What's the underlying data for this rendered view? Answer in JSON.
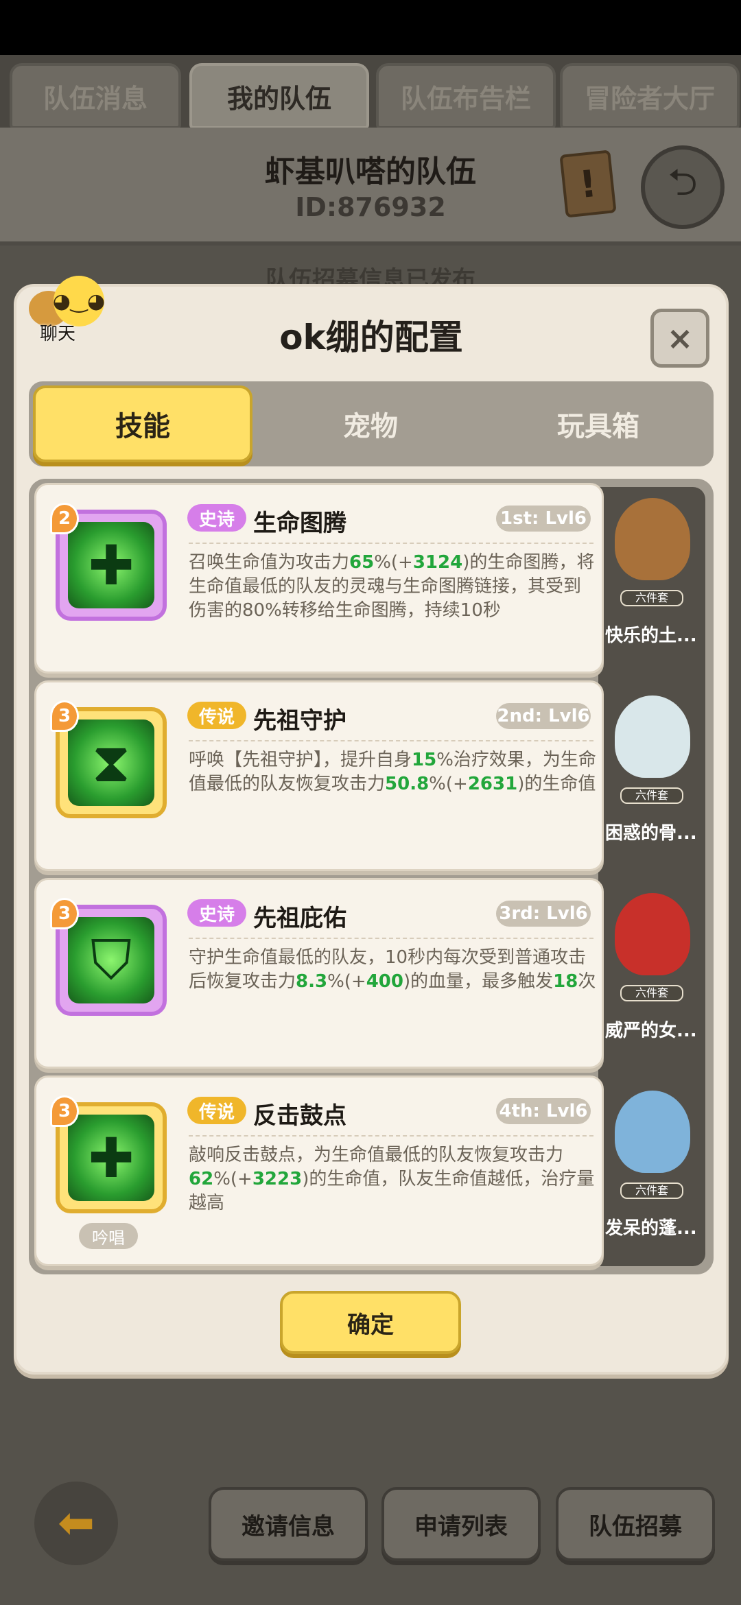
{
  "top_tabs": [
    "队伍消息",
    "我的队伍",
    "队伍布告栏",
    "冒险者大厅"
  ],
  "team": {
    "name": "虾基叭嗒的队伍",
    "id": "ID:876932"
  },
  "bg_notice": "队伍招募信息已发布",
  "chat_label": "聊天",
  "modal": {
    "title": "ok绷的配置",
    "close": "×",
    "categories": [
      "技能",
      "宠物",
      "玩具箱"
    ],
    "confirm": "确定"
  },
  "skills": [
    {
      "badge": "2",
      "rarity": "史诗",
      "name": "生命图腾",
      "level": "1st: Lvl6",
      "desc": [
        {
          "t": "召唤生命值为攻击力"
        },
        {
          "t": "65",
          "g": true
        },
        {
          "t": "%(+"
        },
        {
          "t": "3124",
          "g": true
        },
        {
          "t": ")的生命图腾，将生命值最低的队友的灵魂与生命图腾链接，其受到伤害的80%转移给生命图腾，持续10秒"
        }
      ]
    },
    {
      "badge": "3",
      "rarity": "传说",
      "name": "先祖守护",
      "level": "2nd: Lvl6",
      "desc": [
        {
          "t": "呼唤【先祖守护】，提升自身"
        },
        {
          "t": "15",
          "g": true
        },
        {
          "t": "%治疗效果，为生命值最低的队友恢复攻击力"
        },
        {
          "t": "50.8",
          "g": true
        },
        {
          "t": "%(+"
        },
        {
          "t": "2631",
          "g": true
        },
        {
          "t": ")的生命值"
        }
      ]
    },
    {
      "badge": "3",
      "rarity": "史诗",
      "name": "先祖庇佑",
      "level": "3rd: Lvl6",
      "desc": [
        {
          "t": "守护生命值最低的队友，10秒内每次受到普通攻击后恢复攻击力"
        },
        {
          "t": "8.3",
          "g": true
        },
        {
          "t": "%(+"
        },
        {
          "t": "400",
          "g": true
        },
        {
          "t": ")的血量，最多触发"
        },
        {
          "t": "18",
          "g": true
        },
        {
          "t": "次"
        }
      ]
    },
    {
      "badge": "3",
      "rarity": "传说",
      "name": "反击鼓点",
      "level": "4th: Lvl6",
      "chant": "吟唱",
      "desc": [
        {
          "t": "敲响反击鼓点，为生命值最低的队友恢复攻击力"
        },
        {
          "t": "62",
          "g": true
        },
        {
          "t": "%(+"
        },
        {
          "t": "3223",
          "g": true
        },
        {
          "t": ")的生命值，队友生命值越低，治疗量越高"
        }
      ]
    }
  ],
  "pets": [
    {
      "tag": "六件套",
      "name": "快乐的土..."
    },
    {
      "tag": "六件套",
      "name": "困惑的骨..."
    },
    {
      "tag": "六件套",
      "name": "威严的女..."
    },
    {
      "tag": "六件套",
      "name": "发呆的蓬..."
    }
  ],
  "bottom_buttons": [
    "邀请信息",
    "申请列表",
    "队伍招募"
  ],
  "colors": {
    "accent_yellow": "#ffe067",
    "epic": "#d67ee9",
    "legend": "#f0b62a",
    "value_green": "#22a63b"
  }
}
